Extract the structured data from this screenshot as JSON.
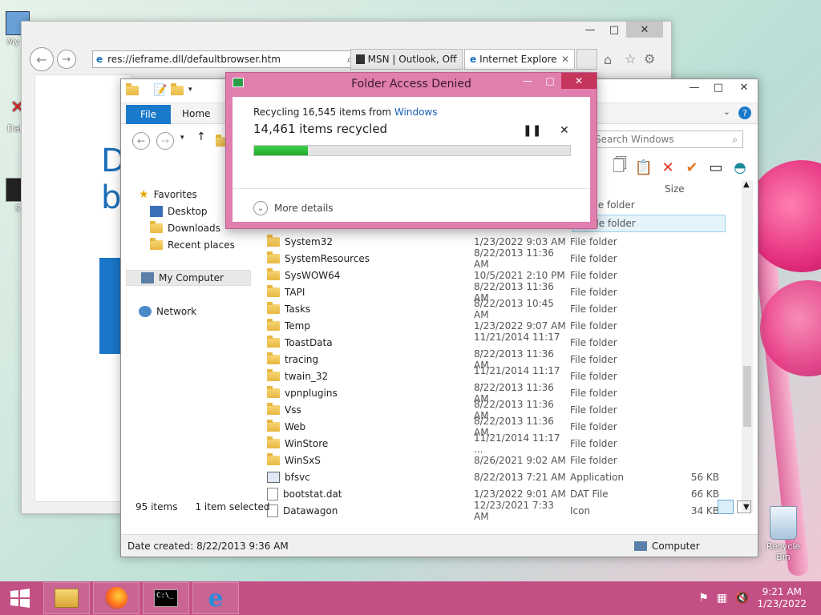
{
  "desktop": {
    "icons": [
      "My C",
      "Data",
      "S"
    ],
    "recycle_bin_label": "Recycle Bin"
  },
  "ie": {
    "address": "res://ieframe.dll/defaultbrowser.htm",
    "tabs": [
      "MSN | Outlook, Offi...",
      "Internet Explorer..."
    ],
    "page_text": "D b"
  },
  "explorer": {
    "ribbon": {
      "file_label": "File",
      "home_label": "Home"
    },
    "search_placeholder": "Search Windows",
    "tree": {
      "favorites": "Favorites",
      "desktop": "Desktop",
      "downloads": "Downloads",
      "recent": "Recent places",
      "my_computer": "My Computer",
      "network": "Network"
    },
    "columns": {
      "size": "Size"
    },
    "rows": [
      {
        "name": "System32",
        "date": "1/23/2022 9:03 AM",
        "type": "File folder",
        "size": "",
        "kind": "folder"
      },
      {
        "name": "SystemResources",
        "date": "8/22/2013 11:36 AM",
        "type": "File folder",
        "size": "",
        "kind": "folder"
      },
      {
        "name": "SysWOW64",
        "date": "10/5/2021 2:10 PM",
        "type": "File folder",
        "size": "",
        "kind": "folder"
      },
      {
        "name": "TAPI",
        "date": "8/22/2013 11:36 AM",
        "type": "File folder",
        "size": "",
        "kind": "folder"
      },
      {
        "name": "Tasks",
        "date": "8/22/2013 10:45 AM",
        "type": "File folder",
        "size": "",
        "kind": "folder"
      },
      {
        "name": "Temp",
        "date": "1/23/2022 9:07 AM",
        "type": "File folder",
        "size": "",
        "kind": "folder"
      },
      {
        "name": "ToastData",
        "date": "11/21/2014 11:17 ...",
        "type": "File folder",
        "size": "",
        "kind": "folder"
      },
      {
        "name": "tracing",
        "date": "8/22/2013 11:36 AM",
        "type": "File folder",
        "size": "",
        "kind": "folder"
      },
      {
        "name": "twain_32",
        "date": "11/21/2014 11:17 ...",
        "type": "File folder",
        "size": "",
        "kind": "folder"
      },
      {
        "name": "vpnplugins",
        "date": "8/22/2013 11:36 AM",
        "type": "File folder",
        "size": "",
        "kind": "folder"
      },
      {
        "name": "Vss",
        "date": "8/22/2013 11:36 AM",
        "type": "File folder",
        "size": "",
        "kind": "folder"
      },
      {
        "name": "Web",
        "date": "8/22/2013 11:36 AM",
        "type": "File folder",
        "size": "",
        "kind": "folder"
      },
      {
        "name": "WinStore",
        "date": "11/21/2014 11:17 ...",
        "type": "File folder",
        "size": "",
        "kind": "folder"
      },
      {
        "name": "WinSxS",
        "date": "8/26/2021 9:02 AM",
        "type": "File folder",
        "size": "",
        "kind": "folder"
      },
      {
        "name": "bfsvc",
        "date": "8/22/2013 7:21 AM",
        "type": "Application",
        "size": "56 KB",
        "kind": "app"
      },
      {
        "name": "bootstat.dat",
        "date": "1/23/2022 9:01 AM",
        "type": "DAT File",
        "size": "66 KB",
        "kind": "file"
      },
      {
        "name": "Datawagon",
        "date": "12/23/2021 7:33 AM",
        "type": "Icon",
        "size": "34 KB",
        "kind": "icon"
      }
    ],
    "partial_rows": [
      "File folder",
      "File folder"
    ],
    "status": {
      "count": "95 items",
      "selected": "1 item selected"
    },
    "details": {
      "created": "Date created: 8/22/2013 9:36 AM",
      "location": "Computer"
    }
  },
  "dialog": {
    "title": "Folder Access Denied",
    "line1_prefix": "Recycling 16,545 items from ",
    "line1_link": "Windows",
    "line2": "14,461 items recycled",
    "progress": 0.17,
    "more_details": "More details"
  },
  "taskbar": {
    "time": "9:21 AM",
    "date": "1/23/2022"
  },
  "colors": {
    "dialog_frame": "#e07eae",
    "taskbar": "#c35085",
    "file_tab": "#1979ca",
    "progress": "#2ab536"
  }
}
